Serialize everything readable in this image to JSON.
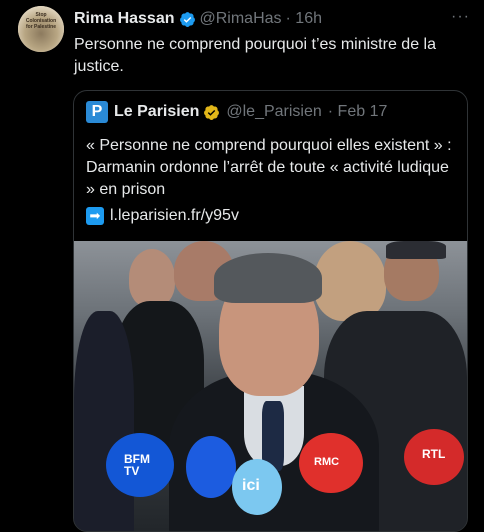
{
  "tweet": {
    "author_name": "Rima Hassan",
    "author_handle": "@RimaHas",
    "time": "· 16h",
    "more": "···",
    "text": "Personne ne comprend pourquoi t’es ministre de la justice.",
    "avatar_text": "Stop Colonisation for Palestine"
  },
  "quote": {
    "logo_letter": "P",
    "author_name": "Le Parisien",
    "author_handle": "@le_Parisien",
    "time": "· Feb 17",
    "text": "« Personne ne comprend pourquoi elles existent » : Darmanin ordonne l’arrêt de toute « activité ludique » en prison",
    "link": "l.leparisien.fr/y95v",
    "arrow": "➡"
  },
  "photo": {
    "mic_labels": [
      "BFM TV",
      "ici",
      "RMC",
      "RTL"
    ]
  },
  "colors": {
    "verified_blue": "#1d9bf0",
    "verified_gold": "#e2b719",
    "muted_text": "#71767b"
  }
}
